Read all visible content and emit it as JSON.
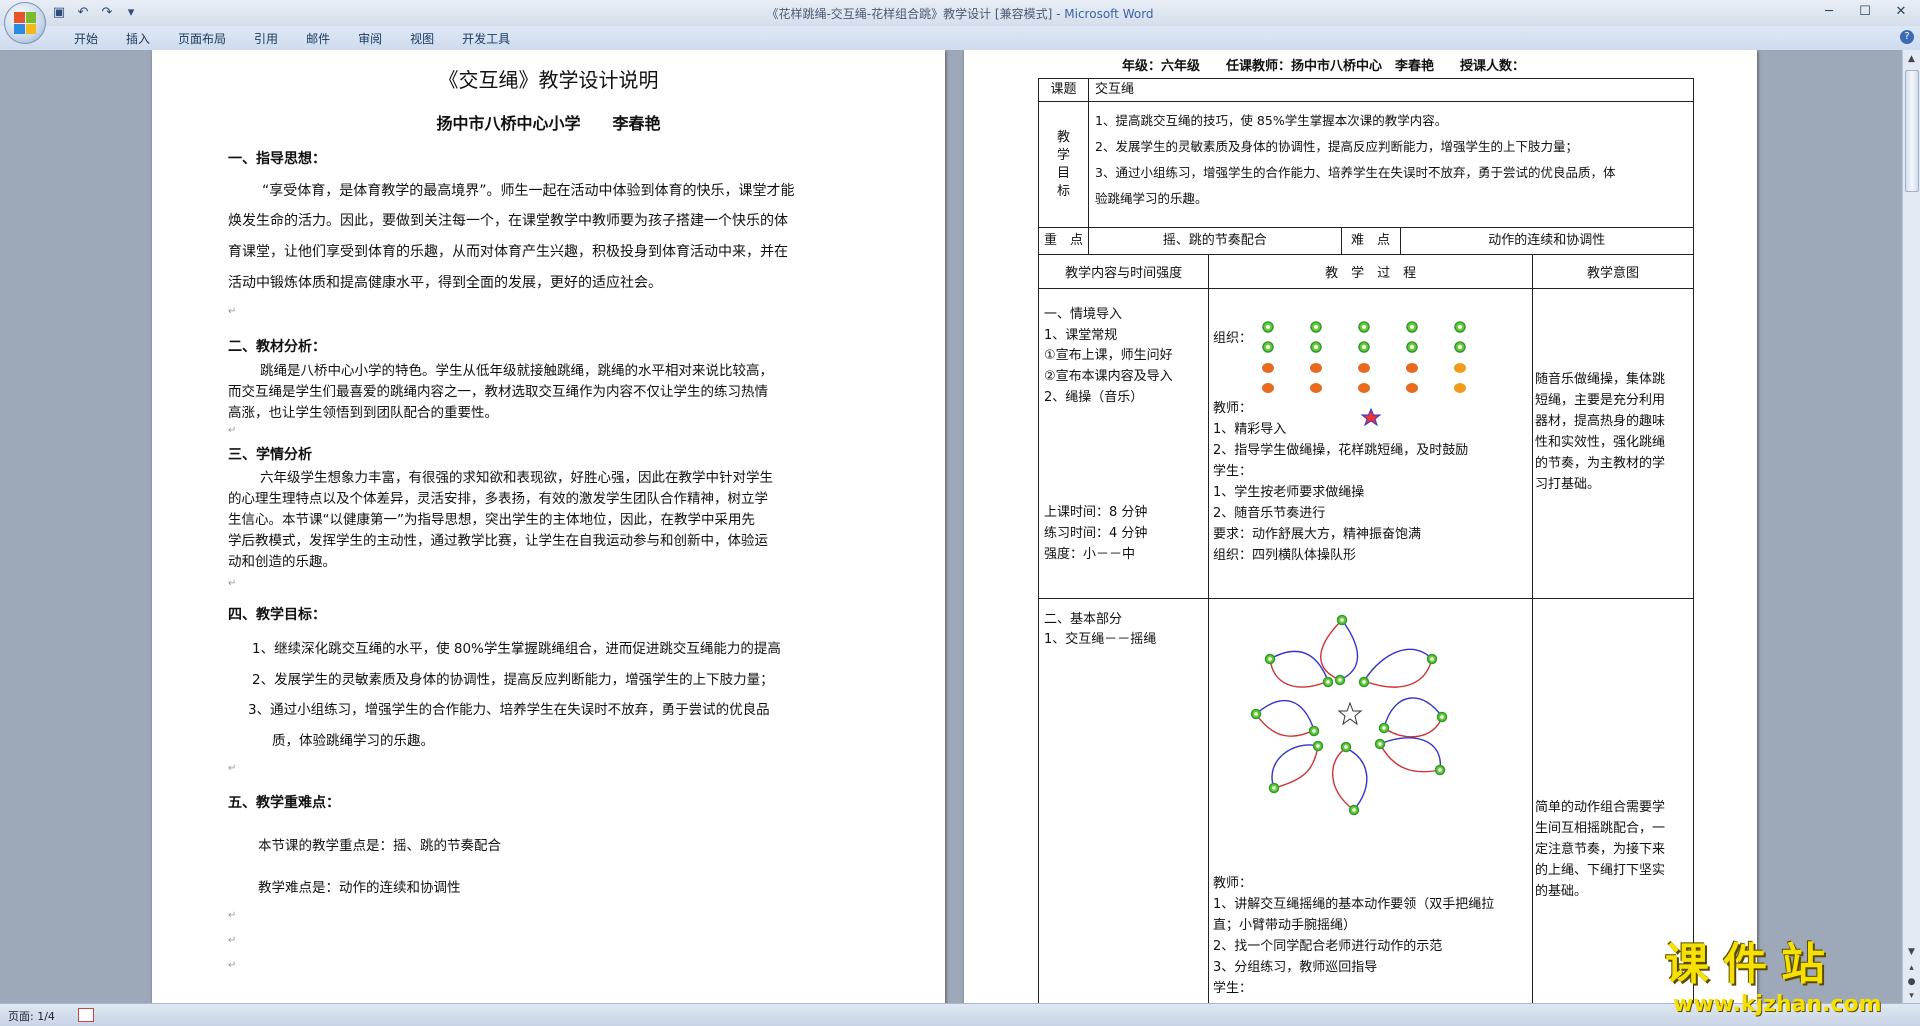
{
  "window": {
    "title": "《花样跳绳-交互绳-花样组合跳》教学设计 [兼容模式] -",
    "app": "Microsoft Word",
    "status_page": "页面: 1/4",
    "watermark_big": "课件站",
    "watermark_small": "www.kjzhan.com"
  },
  "ribbon": {
    "tabs": [
      "开始",
      "插入",
      "页面布局",
      "引用",
      "邮件",
      "审阅",
      "视图",
      "开发工具"
    ]
  },
  "left_page": {
    "title": "《交互绳》教学设计说明",
    "author": "扬中市八桥中心小学　　李春艳",
    "s1_head": "一、指导思想：",
    "s1_l1": "“享受体育，是体育教学的最高境界”。师生一起在活动中体验到体育的快乐，课堂才能",
    "s1_l2": "焕发生命的活力。因此，要做到关注每一个，在课堂教学中教师要为孩子搭建一个快乐的体",
    "s1_l3": "育课堂，让他们享受到体育的乐趣，从而对体育产生兴趣，积极投身到体育活动中来，并在",
    "s1_l4": "活动中锻炼体质和提高健康水平，得到全面的发展，更好的适应社会。",
    "s2_head": "二、教材分析：",
    "s2_l1": "跳绳是八桥中心小学的特色。学生从低年级就接触跳绳，跳绳的水平相对来说比较高，",
    "s2_l2": "而交互绳是学生们最喜爱的跳绳内容之一，教材选取交互绳作为内容不仅让学生的练习热情",
    "s2_l3": "高涨，也让学生领悟到到团队配合的重要性。",
    "s3_head": "三、学情分析",
    "s3_l1": "六年级学生想象力丰富，有很强的求知欲和表现欲，好胜心强，因此在教学中针对学生",
    "s3_l2": "的心理生理特点以及个体差异，灵活安排，多表扬，有效的激发学生团队合作精神，树立学",
    "s3_l3": "生信心。本节课“以健康第一”为指导思想，突出学生的主体地位，因此，在教学中采用先",
    "s3_l4": "学后教模式，发挥学生的主动性，通过教学比赛，让学生在自我运动参与和创新中，体验运",
    "s3_l5": "动和创造的乐趣。",
    "s4_head": "四、教学目标：",
    "s4_l1": "1、继续深化跳交互绳的水平，使 80%学生掌握跳绳组合，进而促进跳交互绳能力的提高",
    "s4_l2": "2、发展学生的灵敏素质及身体的协调性，提高反应判断能力，增强学生的上下肢力量；",
    "s4_l3": "3、通过小组练习，增强学生的合作能力、培养学生在失误时不放弃，勇于尝试的优良品",
    "s4_l4": "质，体验跳绳学习的乐趣。",
    "s5_head": "五、教学重难点：",
    "s5_l1": "本节课的教学重点是：摇、跳的节奏配合",
    "s5_l2": "教学难点是：动作的连续和协调性"
  },
  "right_page": {
    "header": "年级：六年级　　任课教师：扬中市八桥中心　李春艳　　授课人数：",
    "r_topic_label": "课题",
    "r_topic": "交互绳",
    "r_goal_label": [
      "教",
      "学",
      "目",
      "标"
    ],
    "goal1": "1、提高跳交互绳的技巧，使 85%学生掌握本次课的教学内容。",
    "goal2": "2、发展学生的灵敏素质及身体的协调性，提高反应判断能力，增强学生的上下肢力量；",
    "goal3a": "3、通过小组练习，增强学生的合作能力、培养学生在失误时不放弃，勇于尝试的优良品质，体",
    "goal3b": "验跳绳学习的乐趣。",
    "key_label": "重　点",
    "key": "摇、跳的节奏配合",
    "diff_label": "难　点",
    "diff": "动作的连续和协调性",
    "col1": "教学内容与时间强度",
    "col2": "教　学　过　程",
    "col3": "教学意图",
    "p1": [
      "一、情境导入",
      "1、课堂常规",
      "①宣布上课，师生问好",
      "②宣布本课内容及导入",
      "2、绳操（音乐）"
    ],
    "p1_time": [
      "上课时间：8 分钟",
      "练习时间：4 分钟",
      "强度：小－－中"
    ],
    "org_label": "组织：",
    "teacher_label": "教师：",
    "t1": "1、精彩导入",
    "t2": "2、指导学生做绳操，花样跳短绳，及时鼓励",
    "student_label": "学生：",
    "s1": "1、学生按老师要求做绳操",
    "s2": "2、随音乐节奏进行",
    "req": "要求：动作舒展大方，精神振奋饱满",
    "org2": "组织：四列横队体操队形",
    "intent1": [
      "随音乐做绳操，集体跳",
      "短绳，主要是充分利用",
      "器材，提高热身的趣味",
      "性和实效性，强化跳绳",
      "的节奏，为主教材的学",
      "习打基础。"
    ],
    "p2": [
      "二、基本部分",
      "1、交互绳－－摇绳"
    ],
    "t2_label": "教师：",
    "tt1a": "1、讲解交互绳摇绳的基本动作要领（双手把绳拉",
    "tt1b": "直；小臂带动手腕摇绳）",
    "tt2": "2、找一个同学配合老师进行动作的示范",
    "tt3": "3、分组练习，教师巡回指导",
    "st_label": "学生：",
    "intent2": [
      "简单的动作组合需要学",
      "生间互相摇跳配合，一",
      "定注意节奏，为接下来",
      "的上绳、下绳打下坚实",
      "的基础。"
    ]
  }
}
